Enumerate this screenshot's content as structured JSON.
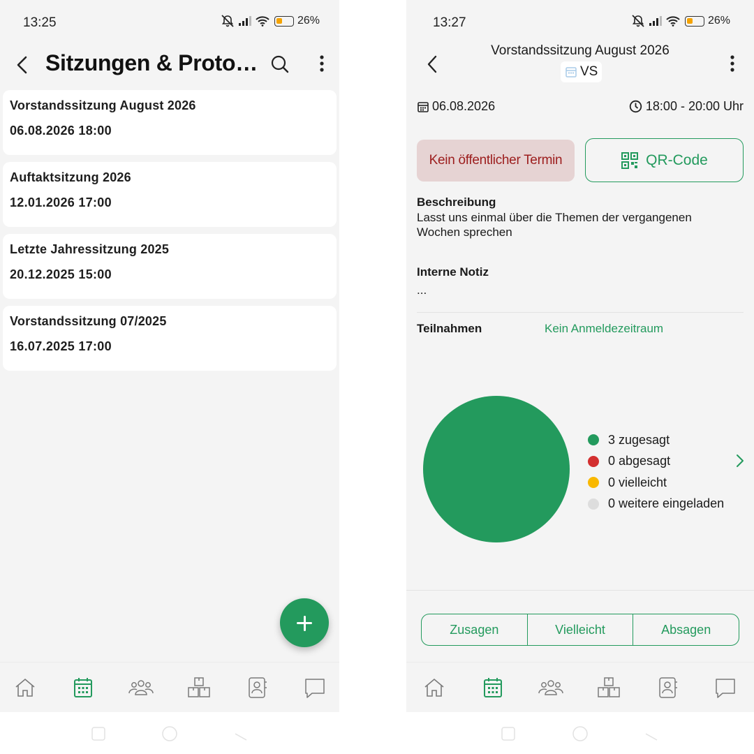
{
  "colors": {
    "accent": "#239a5d",
    "declined": "#d32f2f",
    "maybe": "#f9b800",
    "invited": "#dddddd",
    "badge_bg": "#e6d3d3",
    "badge_text": "#9c1d1d",
    "icon_gray": "#7a7a7a"
  },
  "left": {
    "status": {
      "time": "13:25",
      "battery": "26%"
    },
    "header": {
      "title": "Sitzungen & Proto…",
      "back_icon": "chevron-left-icon",
      "search_icon": "search-icon",
      "menu_icon": "more-vertical-icon"
    },
    "sessions": [
      {
        "title": "Vorstandssitzung August 2026",
        "date": "06.08.2026 18:00"
      },
      {
        "title": "Auftaktsitzung 2026",
        "date": "12.01.2026 17:00"
      },
      {
        "title": "Letzte Jahressitzung 2025",
        "date": "20.12.2025 15:00"
      },
      {
        "title": "Vorstandssitzung 07/2025",
        "date": "16.07.2025 17:00"
      }
    ],
    "fab_icon": "plus-icon"
  },
  "right": {
    "status": {
      "time": "13:27",
      "battery": "26%"
    },
    "header": {
      "title": "Vorstandssitzung August 2026",
      "tag": "VS"
    },
    "date": "06.08.2026",
    "time": "18:00 - 20:00 Uhr",
    "public_badge": "Kein öffentlicher Termin",
    "qr_button": "QR-Code",
    "description_label": "Beschreibung",
    "description_text": "Lasst uns einmal über die Themen der vergangenen Wochen sprechen",
    "note_label": "Interne Notiz",
    "note_text": "...",
    "attendance_label": "Teilnahmen",
    "attendance_status": "Kein Anmeldezeitraum",
    "actions": {
      "accept": "Zusagen",
      "maybe": "Vielleicht",
      "decline": "Absagen"
    }
  },
  "nav_items": [
    "home-icon",
    "calendar-icon",
    "members-icon",
    "inventory-icon",
    "contacts-icon",
    "chat-icon"
  ],
  "chart_data": {
    "type": "pie",
    "categories": [
      "zugesagt",
      "abgesagt",
      "vielleicht",
      "weitere eingeladen"
    ],
    "values": [
      3,
      0,
      0,
      0
    ],
    "legend": [
      "3 zugesagt",
      "0 abgesagt",
      "0 vielleicht",
      "0 weitere eingeladen"
    ],
    "colors": [
      "#239a5d",
      "#d32f2f",
      "#f9b800",
      "#dddddd"
    ],
    "legend_position": "right"
  }
}
